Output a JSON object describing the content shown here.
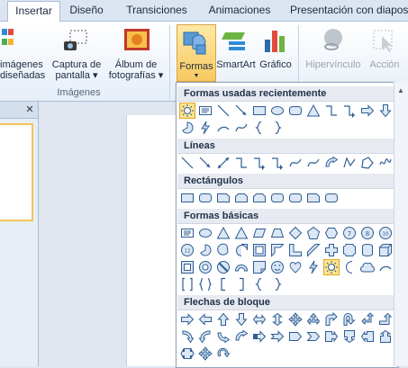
{
  "tabs": [
    "Insertar",
    "Diseño",
    "Transiciones",
    "Animaciones",
    "Presentación con diapos"
  ],
  "ribbon": {
    "imagenes_predisenadas": [
      "imágenes",
      "diseñadas"
    ],
    "captura": [
      "Captura de",
      "pantalla ▾"
    ],
    "album": [
      "Álbum de",
      "fotografías ▾"
    ],
    "group_images": "Imágenes",
    "formas": "Formas",
    "smartart": "SmartArt",
    "grafico": "Gráfico",
    "hipervinculo": "Hipervínculo",
    "accion": "Acción"
  },
  "pane": {
    "close": "✕"
  },
  "shapes_menu": {
    "sections": [
      "Formas usadas recientemente",
      "Líneas",
      "Rectángulos",
      "Formas básicas",
      "Flechas de bloque"
    ],
    "selected_shape": "sun"
  },
  "colors": {
    "accent": "#f2c35a",
    "ribbon_border": "#a9bdd8"
  }
}
